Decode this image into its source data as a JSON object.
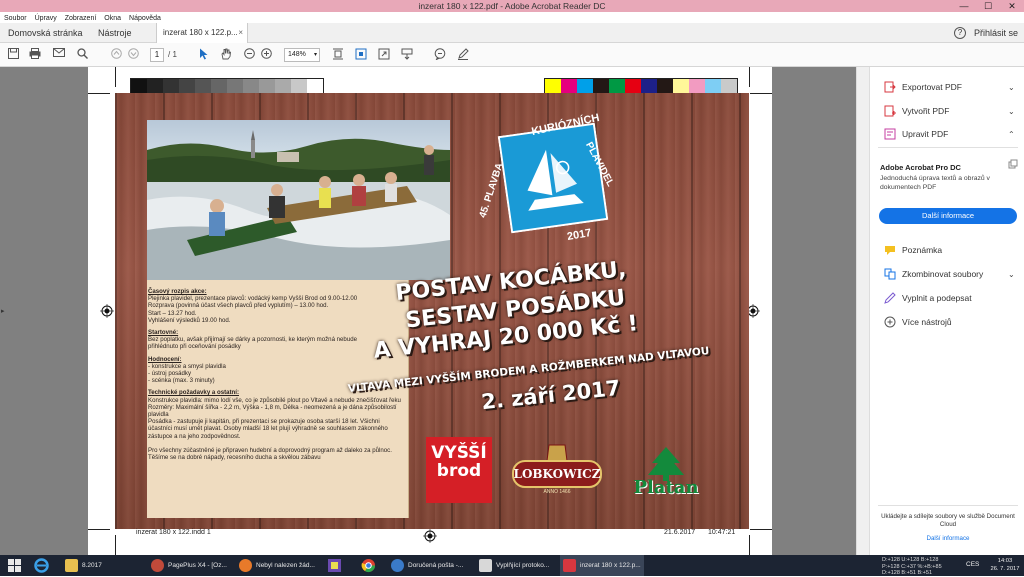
{
  "window": {
    "title": "inzerat 180 x 122.pdf - Adobe Acrobat Reader DC",
    "controls": {
      "minimize": "—",
      "maximize": "☐",
      "close": "✕"
    }
  },
  "menu": [
    "Soubor",
    "Úpravy",
    "Zobrazení",
    "Okna",
    "Nápověda"
  ],
  "tabs": {
    "home": "Domovská stránka",
    "tools": "Nástroje",
    "document": "inzerat 180 x 122.p...",
    "close": "×",
    "help": "?",
    "signin": "Přihlásit se"
  },
  "toolbar": {
    "page_current": "1",
    "page_total": "/ 1",
    "zoom": "148%",
    "zoom_arrow": "▾"
  },
  "colors": {
    "accent": "#1473e6",
    "titlebar": "#e8a8b8",
    "wood": "#8a4a3a",
    "registration_gray": [
      "#111111",
      "#222222",
      "#333333",
      "#444444",
      "#555555",
      "#666666",
      "#777777",
      "#888888",
      "#999999",
      "#aaaaaa",
      "#c8c8c8",
      "#ffffff"
    ],
    "registration_color": [
      "#ffff00",
      "#e6007e",
      "#00a0e9",
      "#231815",
      "#009944",
      "#e60012",
      "#1d2088",
      "#231815",
      "#fff799",
      "#f29bc1",
      "#7ecef4",
      "#c9caca"
    ]
  },
  "document": {
    "badge": {
      "ring_top": "KURIÓZNÍCH",
      "ring_left": "45. PLAVBA",
      "ring_right": "PLAVIDEL",
      "year": "2017"
    },
    "slogan": {
      "line1": "POSTAV KOCÁBKU,",
      "line2": "SESTAV POSÁDKU",
      "line3": "A VYHRAJ 20 000 Kč !",
      "line4": "VLTAVA MEZI VYŠŠÍM BRODEM A ROŽMBERKEM NAD VLTAVOU",
      "line5": "2. září 2017"
    },
    "info": {
      "h1": "Časový rozpis akce:",
      "t1": [
        "Plejinka plavidel, prezentace plavců: vodácký kemp Vyšší Brod od 9.00-12.00",
        "Rozprava (povinná účast všech plavců před vyplutím) – 13.00 hod.",
        "Start – 13.27 hod.",
        "Vyhlášení výsledků 19.00 hod."
      ],
      "h2": "Startovné:",
      "t2": [
        "Bez poplatku, avšak přijímají se dárky a pozornosti, ke kterým možná nebude",
        "přihlédnuto při oceňování posádky"
      ],
      "h3": "Hodnocení:",
      "t3": [
        "- konstrukce a smysl plavidla",
        "- ústroj posádky",
        "- scénka (max. 3 minuty)"
      ],
      "h4": "Technické požadavky a ostatní:",
      "t4": [
        "Konstrukce plavidla: mimo lodí vše, co je způsobilé plout po Vltavě a nebude znečišťovat řeku",
        "Rozměry: Maximální šířka - 2,2 m, Výška - 1,8 m, Délka - neomezená a je dána způsobilostí",
        "plavidla",
        "Posádka - zastupuje ji kapitán, při prezentaci se prokazuje osoba starší 18 let. Všichni",
        "účastníci musí umět plavat. Osoby mladší 18 let plují výhradně se souhlasem zákonného",
        "zástupce a na jeho zodpovědnost."
      ],
      "t5": [
        "Pro všechny zúčastněné je připraven hudební a doprovodný program až daleko za půlnoc.",
        "Těšíme se na dobré nápady, recesního ducha a skvělou zábavu"
      ]
    },
    "sponsors": {
      "vyssi_brod": [
        "VYŠŠÍ",
        "brod"
      ],
      "lobkowicz": "LOBKOWICZ",
      "lobkowicz_sub": "ANNO 1466",
      "platan": "Platan"
    },
    "footer": {
      "file": "inzerat 180 x 122.indd   1",
      "date": "21.6.2017",
      "time": "10:47:21"
    }
  },
  "rightpane": {
    "items": [
      {
        "label": "Exportovat PDF",
        "icon": "export-pdf-icon",
        "chevron": "⌄"
      },
      {
        "label": "Vytvořit PDF",
        "icon": "create-pdf-icon",
        "chevron": "⌄"
      },
      {
        "label": "Upravit PDF",
        "icon": "edit-pdf-icon",
        "chevron": "⌃"
      }
    ],
    "promo_title": "Adobe Acrobat Pro DC",
    "promo_desc": "Jednoduchá úprava textů a obrazů v dokumentech PDF",
    "promo_button": "Další informace",
    "tools": [
      {
        "label": "Poznámka",
        "icon": "comment-icon"
      },
      {
        "label": "Zkombinovat soubory",
        "icon": "combine-files-icon",
        "chevron": "⌄"
      },
      {
        "label": "Vyplnit a podepsat",
        "icon": "sign-icon"
      },
      {
        "label": "Více nástrojů",
        "icon": "more-tools-icon"
      }
    ],
    "cloud_text": "Ukládejte a sdílejte soubory ve službě Document Cloud",
    "cloud_link": "Další informace"
  },
  "taskbar": {
    "items": [
      {
        "label": "8.2017",
        "icon": "folder-icon"
      },
      {
        "label": "PagePlus X4 - [Oz...",
        "icon": "pageplus-icon"
      },
      {
        "label": "Nebyl nalezen žád...",
        "icon": "firefox-icon"
      },
      {
        "label": "Doručená pošta -...",
        "icon": "thunderbird-icon"
      },
      {
        "label": "Vyplňjící protoko...",
        "icon": "document-icon"
      },
      {
        "label": "inzerat 180 x 122.p...",
        "icon": "acrobat-icon"
      }
    ],
    "tray_lines": [
      "D:+128 U:+128 B:+128",
      "P:+128 C:+37 %:+B:+85",
      "D:+128 B:+51 B:+51"
    ],
    "lang": "CES",
    "time": "14:03",
    "date": "26. 7. 2017"
  }
}
